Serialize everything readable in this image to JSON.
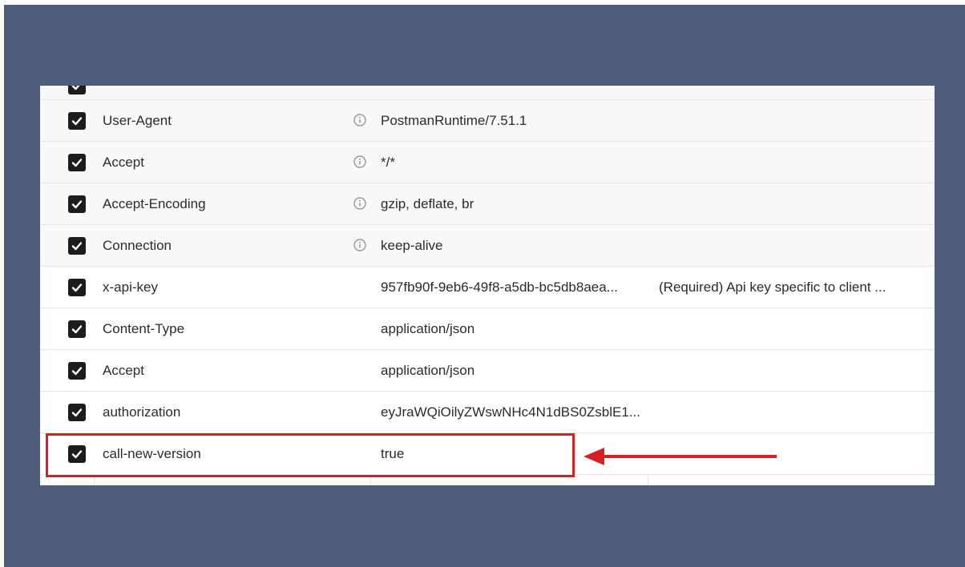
{
  "headers": {
    "rows": [
      {
        "key": "",
        "value": "",
        "description": "",
        "auto": true
      },
      {
        "key": "User-Agent",
        "value": "PostmanRuntime/7.51.1",
        "description": "",
        "auto": true
      },
      {
        "key": "Accept",
        "value": "*/*",
        "description": "",
        "auto": true
      },
      {
        "key": "Accept-Encoding",
        "value": "gzip, deflate, br",
        "description": "",
        "auto": true
      },
      {
        "key": "Connection",
        "value": "keep-alive",
        "description": "",
        "auto": true
      },
      {
        "key": "x-api-key",
        "value": "957fb90f-9eb6-49f8-a5db-bc5db8aea...",
        "description": "(Required) Api key specific to client ...",
        "auto": false
      },
      {
        "key": "Content-Type",
        "value": "application/json",
        "description": "",
        "auto": false
      },
      {
        "key": "Accept",
        "value": "application/json",
        "description": "",
        "auto": false
      },
      {
        "key": "authorization",
        "value": "eyJraWQiOilyZWswNHc4N1dBS0ZsblE1...",
        "description": "",
        "auto": false
      },
      {
        "key": "call-new-version",
        "value": "true",
        "description": "",
        "auto": false
      }
    ],
    "checked": true
  },
  "annotation": {
    "highlight_color": "#d71f26",
    "highlighted_row": "call-new-version"
  },
  "colors": {
    "background": "#4f5d7c",
    "checkbox": "#1c1c1c",
    "auto_row": "#f8f8f8"
  },
  "icons": {
    "checkbox": "checkbox-checked-icon",
    "info": "info-icon",
    "arrow": "arrow-left-icon"
  }
}
